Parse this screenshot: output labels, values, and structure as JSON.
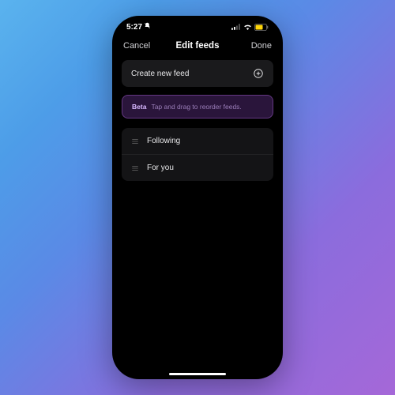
{
  "status": {
    "time": "5:27",
    "dnd_icon": "bell-slash-icon",
    "signal_icon": "signal-icon",
    "wifi_icon": "wifi-icon",
    "battery_icon": "battery-low-power-icon"
  },
  "nav": {
    "cancel": "Cancel",
    "title": "Edit feeds",
    "done": "Done"
  },
  "create": {
    "label": "Create new feed",
    "icon": "plus-circle-icon"
  },
  "banner": {
    "badge": "Beta",
    "message": "Tap and drag to reorder feeds."
  },
  "feeds": [
    {
      "label": "Following"
    },
    {
      "label": "For you"
    }
  ]
}
